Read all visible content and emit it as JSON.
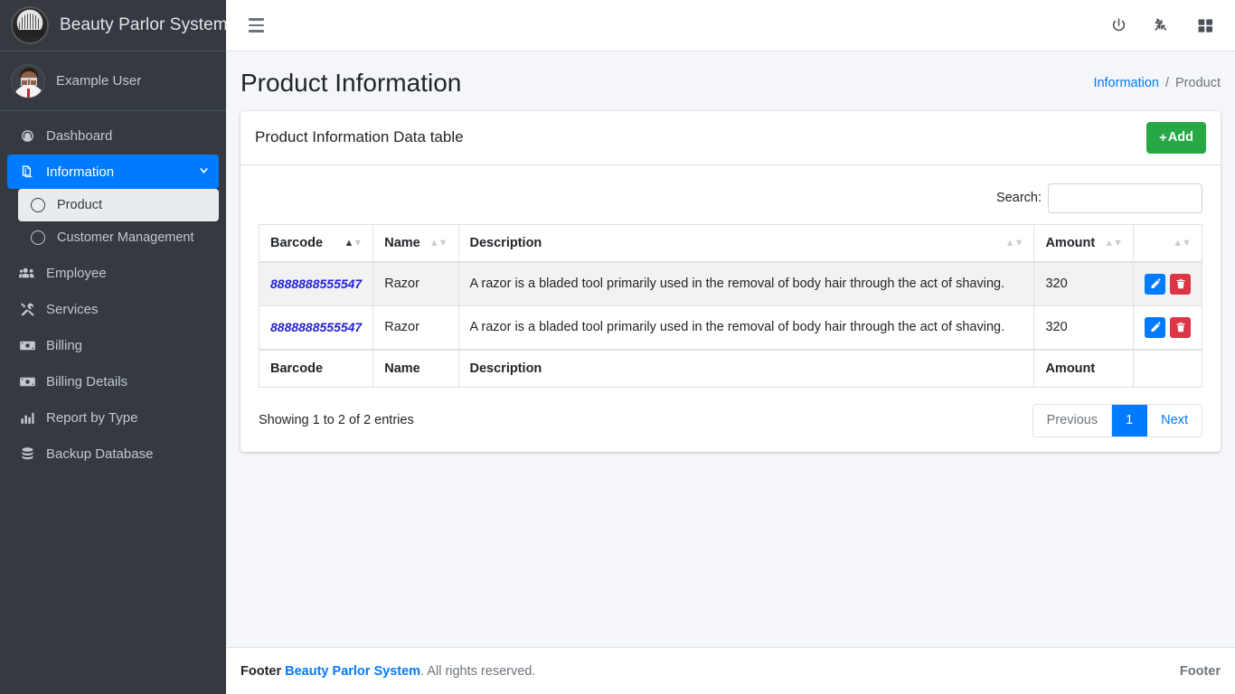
{
  "brand": {
    "name": "Beauty Parlor System",
    "logo_icon": "parlor-badge-logo"
  },
  "user_panel": {
    "name": "Example User",
    "avatar_icon": "user-avatar"
  },
  "sidebar": {
    "items": [
      {
        "label": "Dashboard",
        "icon": "tachometer-icon",
        "active": false
      },
      {
        "label": "Information",
        "icon": "copy-files-icon",
        "active": true,
        "chevron": "❯"
      },
      {
        "label": "Employee",
        "icon": "users-icon",
        "active": false
      },
      {
        "label": "Services",
        "icon": "tools-icon",
        "active": false
      },
      {
        "label": "Billing",
        "icon": "money-bill-icon",
        "active": false
      },
      {
        "label": "Billing Details",
        "icon": "money-bill-icon",
        "active": false
      },
      {
        "label": "Report by Type",
        "icon": "chart-bar-icon",
        "active": false
      },
      {
        "label": "Backup Database",
        "icon": "database-icon",
        "active": false
      }
    ],
    "submenu": [
      {
        "label": "Product",
        "icon": "circle-icon",
        "active": true
      },
      {
        "label": "Customer Management",
        "icon": "circle-icon",
        "active": false
      }
    ]
  },
  "navbar": {
    "hamburger_icon": "bars-icon",
    "power_icon": "power-off-icon",
    "compress_icon": "compress-arrows-icon",
    "grid_icon": "th-large-grid-icon"
  },
  "header": {
    "title": "Product Information",
    "breadcrumb": {
      "parent": "Information",
      "separator": "/",
      "current": "Product"
    }
  },
  "card": {
    "title": "Product Information Data table",
    "add_button": {
      "plus": "+",
      "label": "Add"
    }
  },
  "datatable": {
    "search_label": "Search:",
    "search_value": "",
    "search_placeholder": "",
    "columns": [
      {
        "label": "Barcode",
        "sort": "asc"
      },
      {
        "label": "Name",
        "sort": "none"
      },
      {
        "label": "Description",
        "sort": "none"
      },
      {
        "label": "Amount",
        "sort": "none"
      },
      {
        "label": "",
        "sort": "none"
      }
    ],
    "rows": [
      {
        "barcode": "8888888555547",
        "name": "Razor",
        "description": "A razor is a bladed tool primarily used in the removal of body hair through the act of shaving.",
        "amount": "320",
        "edit_icon": "pencil-icon",
        "delete_icon": "trash-icon"
      },
      {
        "barcode": "8888888555547",
        "name": "Razor",
        "description": "A razor is a bladed tool primarily used in the removal of body hair through the act of shaving.",
        "amount": "320",
        "edit_icon": "pencil-icon",
        "delete_icon": "trash-icon"
      }
    ],
    "footer_columns": [
      "Barcode",
      "Name",
      "Description",
      "Amount",
      ""
    ],
    "info": "Showing 1 to 2 of 2 entries",
    "pagination": {
      "previous": "Previous",
      "pages": [
        "1"
      ],
      "next": "Next",
      "active_page": "1"
    }
  },
  "footer": {
    "prefix": "Footer",
    "link": "Beauty Parlor System",
    "suffix": ". All rights reserved.",
    "right": "Footer"
  },
  "colors": {
    "sidebar_bg": "#343a40",
    "accent_blue": "#007bff",
    "success_green": "#28a745",
    "danger_red": "#dc3545",
    "content_bg": "#f4f6f9",
    "barcode_link": "#2323d6"
  }
}
